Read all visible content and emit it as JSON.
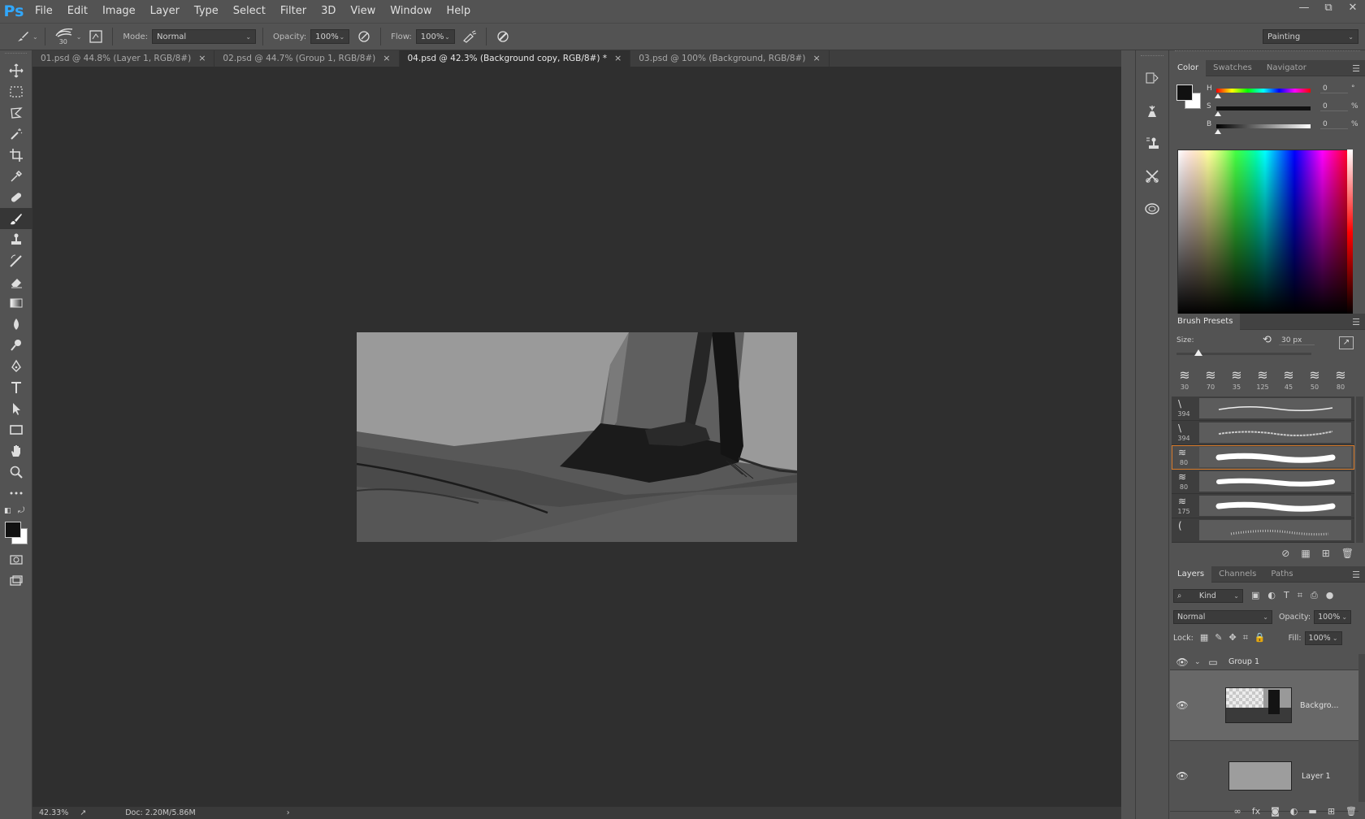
{
  "app": {
    "logo": "Ps"
  },
  "menu": [
    "File",
    "Edit",
    "Image",
    "Layer",
    "Type",
    "Select",
    "Filter",
    "3D",
    "View",
    "Window",
    "Help"
  ],
  "window_controls": {
    "minimize": "—",
    "restore": "⧉",
    "close": "✕"
  },
  "options": {
    "brush_size": "30",
    "mode_label": "Mode:",
    "mode_value": "Normal",
    "opacity_label": "Opacity:",
    "opacity_value": "100%",
    "flow_label": "Flow:",
    "flow_value": "100%",
    "workspace": "Painting"
  },
  "tabs": [
    {
      "label": "01.psd @ 44.8% (Layer 1, RGB/8#)",
      "active": false
    },
    {
      "label": "02.psd @ 44.7% (Group 1, RGB/8#)",
      "active": false
    },
    {
      "label": "04.psd @ 42.3% (Background copy, RGB/8#) *",
      "active": true
    },
    {
      "label": "03.psd @ 100% (Background, RGB/8#)",
      "active": false
    }
  ],
  "tab_close": "×",
  "status": {
    "zoom": "42.33%",
    "doc": "Doc: 2.20M/5.86M",
    "arrow": "›"
  },
  "color_panel": {
    "tabs": [
      "Color",
      "Swatches",
      "Navigator"
    ],
    "h_label": "H",
    "h_value": "0",
    "h_unit": "°",
    "s_label": "S",
    "s_value": "0",
    "s_unit": "%",
    "b_label": "B",
    "b_value": "0",
    "b_unit": "%",
    "foreground": "#111111",
    "background": "#ffffff"
  },
  "brush_presets": {
    "title": "Brush Presets",
    "size_label": "Size:",
    "size_value": "30 px",
    "recent": [
      "30",
      "70",
      "35",
      "125",
      "45",
      "50",
      "80"
    ],
    "list": [
      {
        "num": "394",
        "selected": false
      },
      {
        "num": "394",
        "selected": false
      },
      {
        "num": "80",
        "selected": true
      },
      {
        "num": "80",
        "selected": false
      },
      {
        "num": "175",
        "selected": false
      },
      {
        "num": "",
        "selected": false
      }
    ]
  },
  "layers_panel": {
    "tabs": [
      "Layers",
      "Channels",
      "Paths"
    ],
    "filter_label": "Kind",
    "blend_mode": "Normal",
    "opacity_label": "Opacity:",
    "opacity_value": "100%",
    "lock_label": "Lock:",
    "fill_label": "Fill:",
    "fill_value": "100%",
    "layers": [
      {
        "name": "Group 1",
        "type": "group"
      },
      {
        "name": "Backgro...",
        "type": "layer",
        "selected": true
      },
      {
        "name": "Layer 1",
        "type": "layer",
        "selected": false
      }
    ]
  },
  "colors": {
    "canvas_bg": "#2f2f2f",
    "ui_bg": "#535353",
    "accent_logo": "#31a8ff",
    "selection_outline": "#d87b2b"
  }
}
